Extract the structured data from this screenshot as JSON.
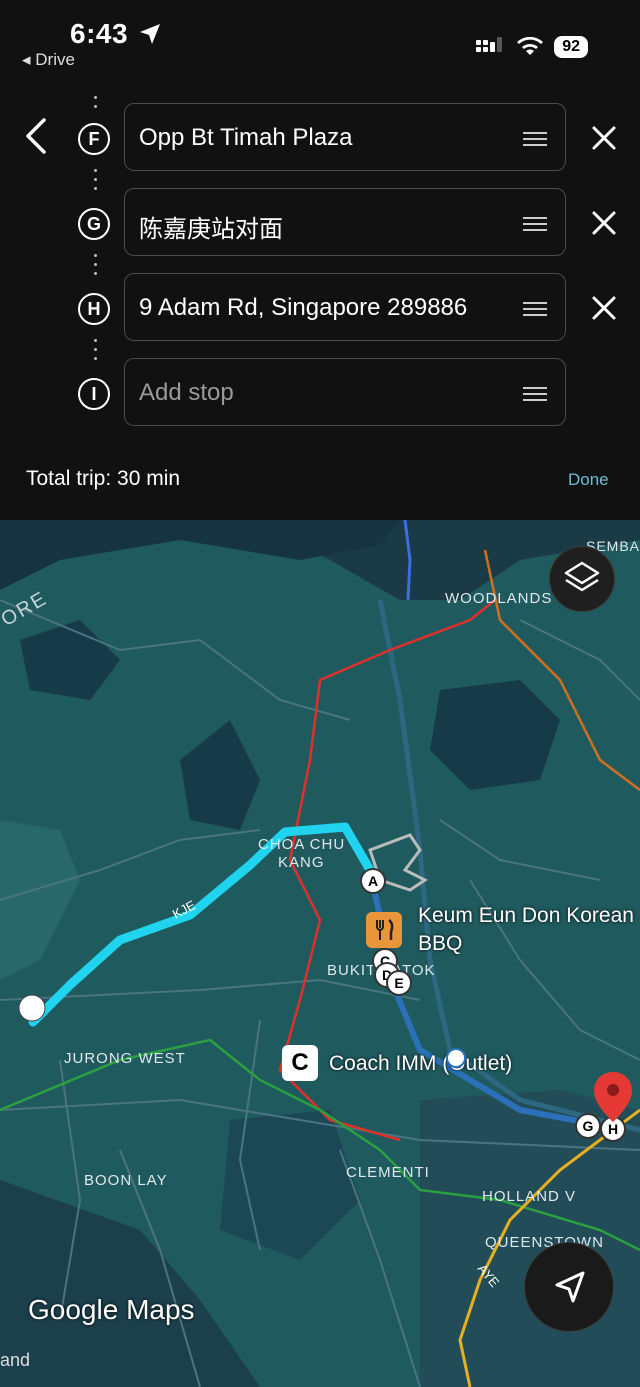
{
  "status_bar": {
    "time": "6:43",
    "back_app": "Drive",
    "battery": "92"
  },
  "stops": [
    {
      "letter": "F",
      "value": "Opp Bt Timah Plaza",
      "placeholder": ""
    },
    {
      "letter": "G",
      "value": "陈嘉庚站对面",
      "placeholder": ""
    },
    {
      "letter": "H",
      "value": "9 Adam Rd, Singapore 289886",
      "placeholder": ""
    },
    {
      "letter": "I",
      "value": "",
      "placeholder": "Add stop"
    }
  ],
  "trip": {
    "total": "Total trip: 30 min",
    "done_label": "Done"
  },
  "map": {
    "labels": {
      "woodlands": "WOODLANDS",
      "sembawang": "SEMBA",
      "ore": "ORE",
      "choa_chu_kang_1": "CHOA CHU",
      "choa_chu_kang_2": "KANG",
      "kje": "KJE",
      "bukit_batok": "BUKIT BATOK",
      "jurong_west": "JURONG WEST",
      "boon_lay": "BOON LAY",
      "clementi": "CLEMENTI",
      "holland": "HOLLAND V",
      "queenstown": "QUEENSTOWN",
      "aye": "AYE"
    },
    "pois": {
      "restaurant_1": "Keum Eun Don Korean",
      "restaurant_2": "BBQ",
      "coach": "Coach IMM (Outlet)"
    },
    "markers": {
      "a": "A",
      "c": "C",
      "d": "D",
      "e": "E",
      "g": "G",
      "h": "H"
    },
    "logo": "Google Maps",
    "edge_text": "and",
    "route_color": "#20d4f0",
    "water_color": "#1a3a46",
    "land_color": "#1f5a5e"
  }
}
